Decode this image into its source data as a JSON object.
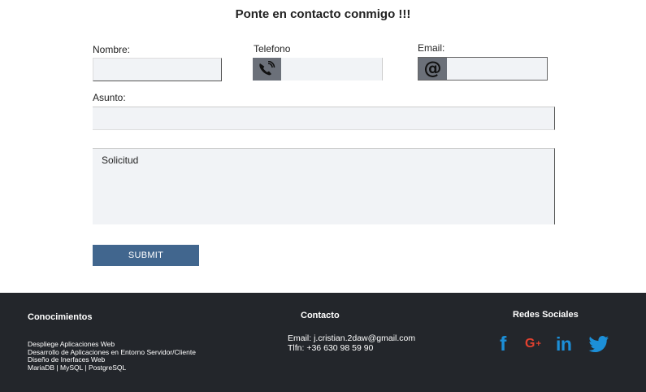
{
  "page_title": "Ponte en contacto conmigo !!!",
  "form": {
    "nombre_label": "Nombre:",
    "nombre_value": "",
    "telefono_label": "Telefono",
    "telefono_value": "",
    "telefono_icon": "phone-icon",
    "email_label": "Email:",
    "email_value": "",
    "email_icon": "at-sign-icon",
    "asunto_label": "Asunto:",
    "asunto_value": "",
    "solicitud_placeholder": "Solicitud",
    "submit_label": "SUBMIT"
  },
  "footer": {
    "conocimientos": {
      "heading": "Conocimientos",
      "items": [
        "Despliege Aplicaciones Web",
        "Desarrollo de Aplicaciones en Entorno Servidor/Cliente",
        "Diseño de Inerfaces Web",
        "MariaDB | MySQL | PostgreSQL"
      ]
    },
    "contacto": {
      "heading": "Contacto",
      "email": "Email: j.cristian.2daw@gmail.com",
      "phone": "Tlfn: +36 630 98 59 90"
    },
    "redes": {
      "heading": "Redes Sociales",
      "icons": [
        "facebook-icon",
        "google-plus-icon",
        "linkedin-icon",
        "twitter-icon"
      ]
    }
  },
  "colors": {
    "submit_bg": "#41668e",
    "footer_bg": "#23262b",
    "input_bg": "#f1f3f6",
    "social_blue": "#1c8fd8",
    "social_red": "#e3412f"
  }
}
